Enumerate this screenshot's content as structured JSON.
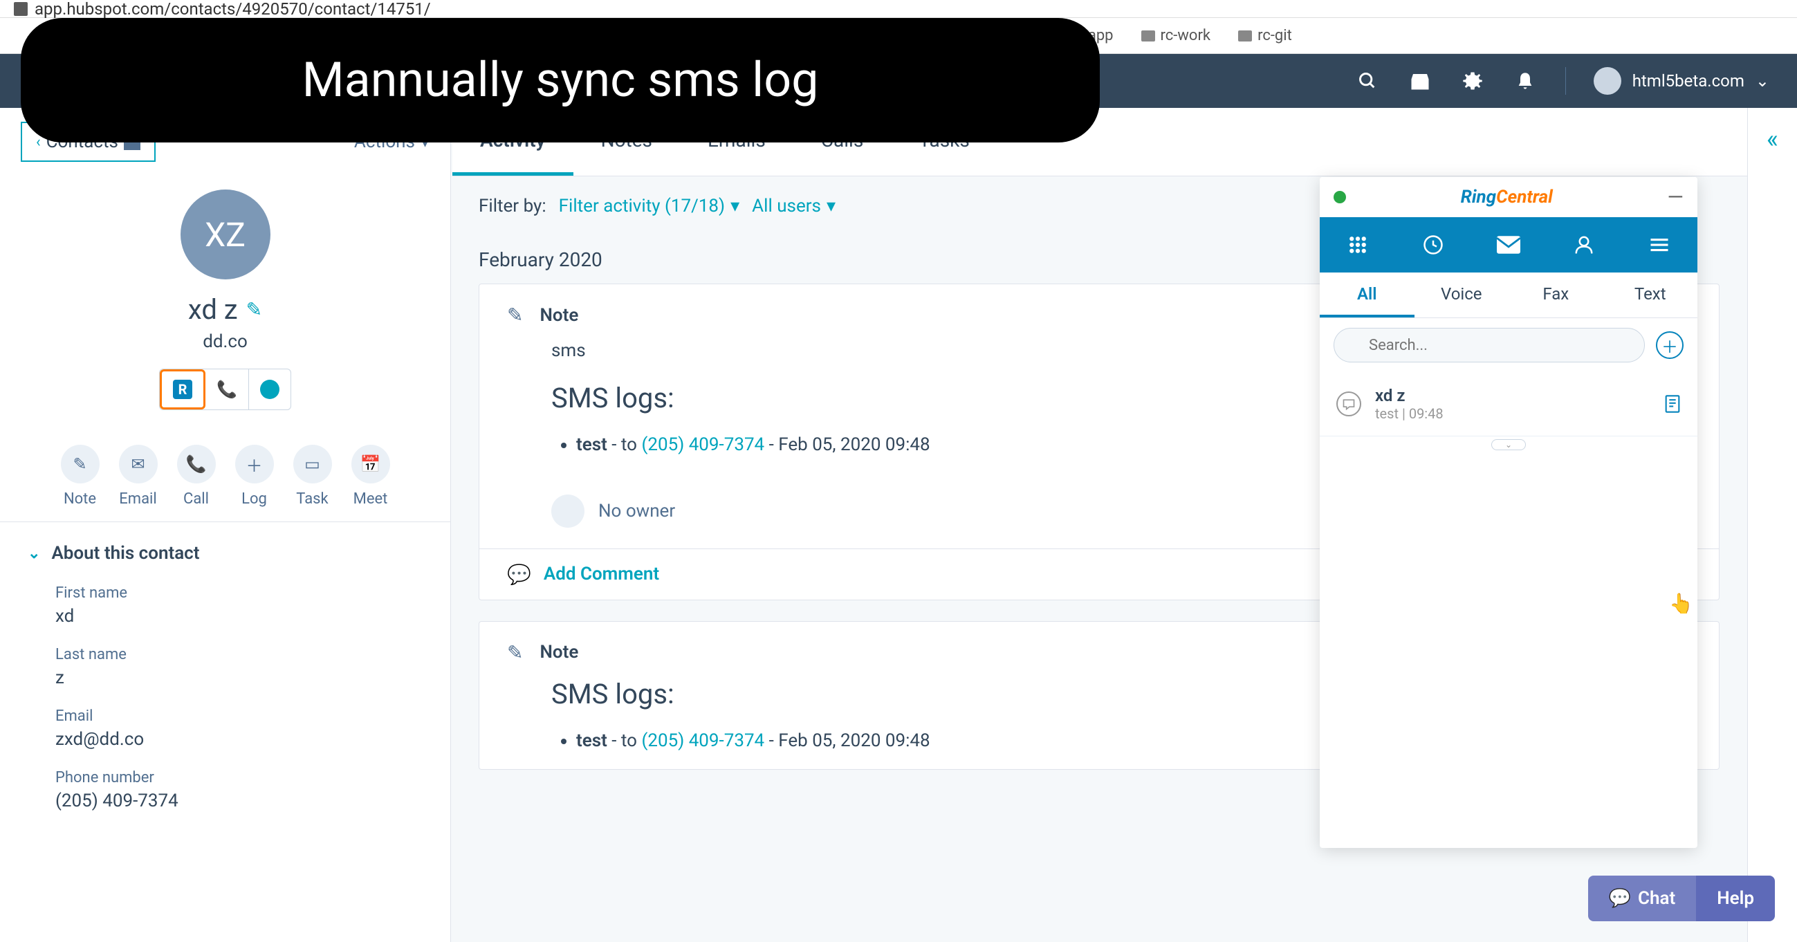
{
  "browser": {
    "url": "app.hubspot.com/contacts/4920570/contact/14751/",
    "bookmarks": [
      "rc-app",
      "rc-work",
      "rc-git"
    ]
  },
  "caption": "Mannually sync sms log",
  "topnav": {
    "account": "html5beta.com"
  },
  "sidebar": {
    "back_label": "Contacts",
    "actions_label": "Actions",
    "avatar_initials": "XZ",
    "contact_name": "xd z",
    "company": "dd.co",
    "actions": [
      {
        "label": "Note"
      },
      {
        "label": "Email"
      },
      {
        "label": "Call"
      },
      {
        "label": "Log"
      },
      {
        "label": "Task"
      },
      {
        "label": "Meet"
      }
    ],
    "about_title": "About this contact",
    "fields": {
      "first_name_label": "First name",
      "first_name_value": "xd",
      "last_name_label": "Last name",
      "last_name_value": "z",
      "email_label": "Email",
      "email_value": "zxd@dd.co",
      "phone_label": "Phone number",
      "phone_value": "(205) 409-7374"
    }
  },
  "tabs": [
    "Activity",
    "Notes",
    "Emails",
    "Calls",
    "Tasks"
  ],
  "filter": {
    "label": "Filter by:",
    "activity": "Filter activity (17/18)",
    "users": "All users"
  },
  "timeline": {
    "month": "February 2020",
    "cards": [
      {
        "type": "Note",
        "body_text": "sms",
        "heading": "SMS logs:",
        "item_prefix": "test",
        "item_to": " - to ",
        "item_phone": "(205) 409-7374",
        "item_suffix": " - Feb 05, 2020 09:48",
        "owner": "No owner",
        "add_comment": "Add Comment"
      },
      {
        "type": "Note",
        "heading": "SMS logs:",
        "item_prefix": "test",
        "item_to": " - to ",
        "item_phone": "(205) 409-7374",
        "item_suffix": " - Feb 05, 2020 09:48"
      }
    ]
  },
  "ringcentral": {
    "brand_ring": "Ring",
    "brand_central": "Central",
    "tabs": [
      "All",
      "Voice",
      "Fax",
      "Text"
    ],
    "search_placeholder": "Search...",
    "messages": [
      {
        "name": "xd z",
        "preview": "test",
        "time": "09:48"
      }
    ]
  },
  "help": {
    "chat": "Chat",
    "help": "Help"
  }
}
